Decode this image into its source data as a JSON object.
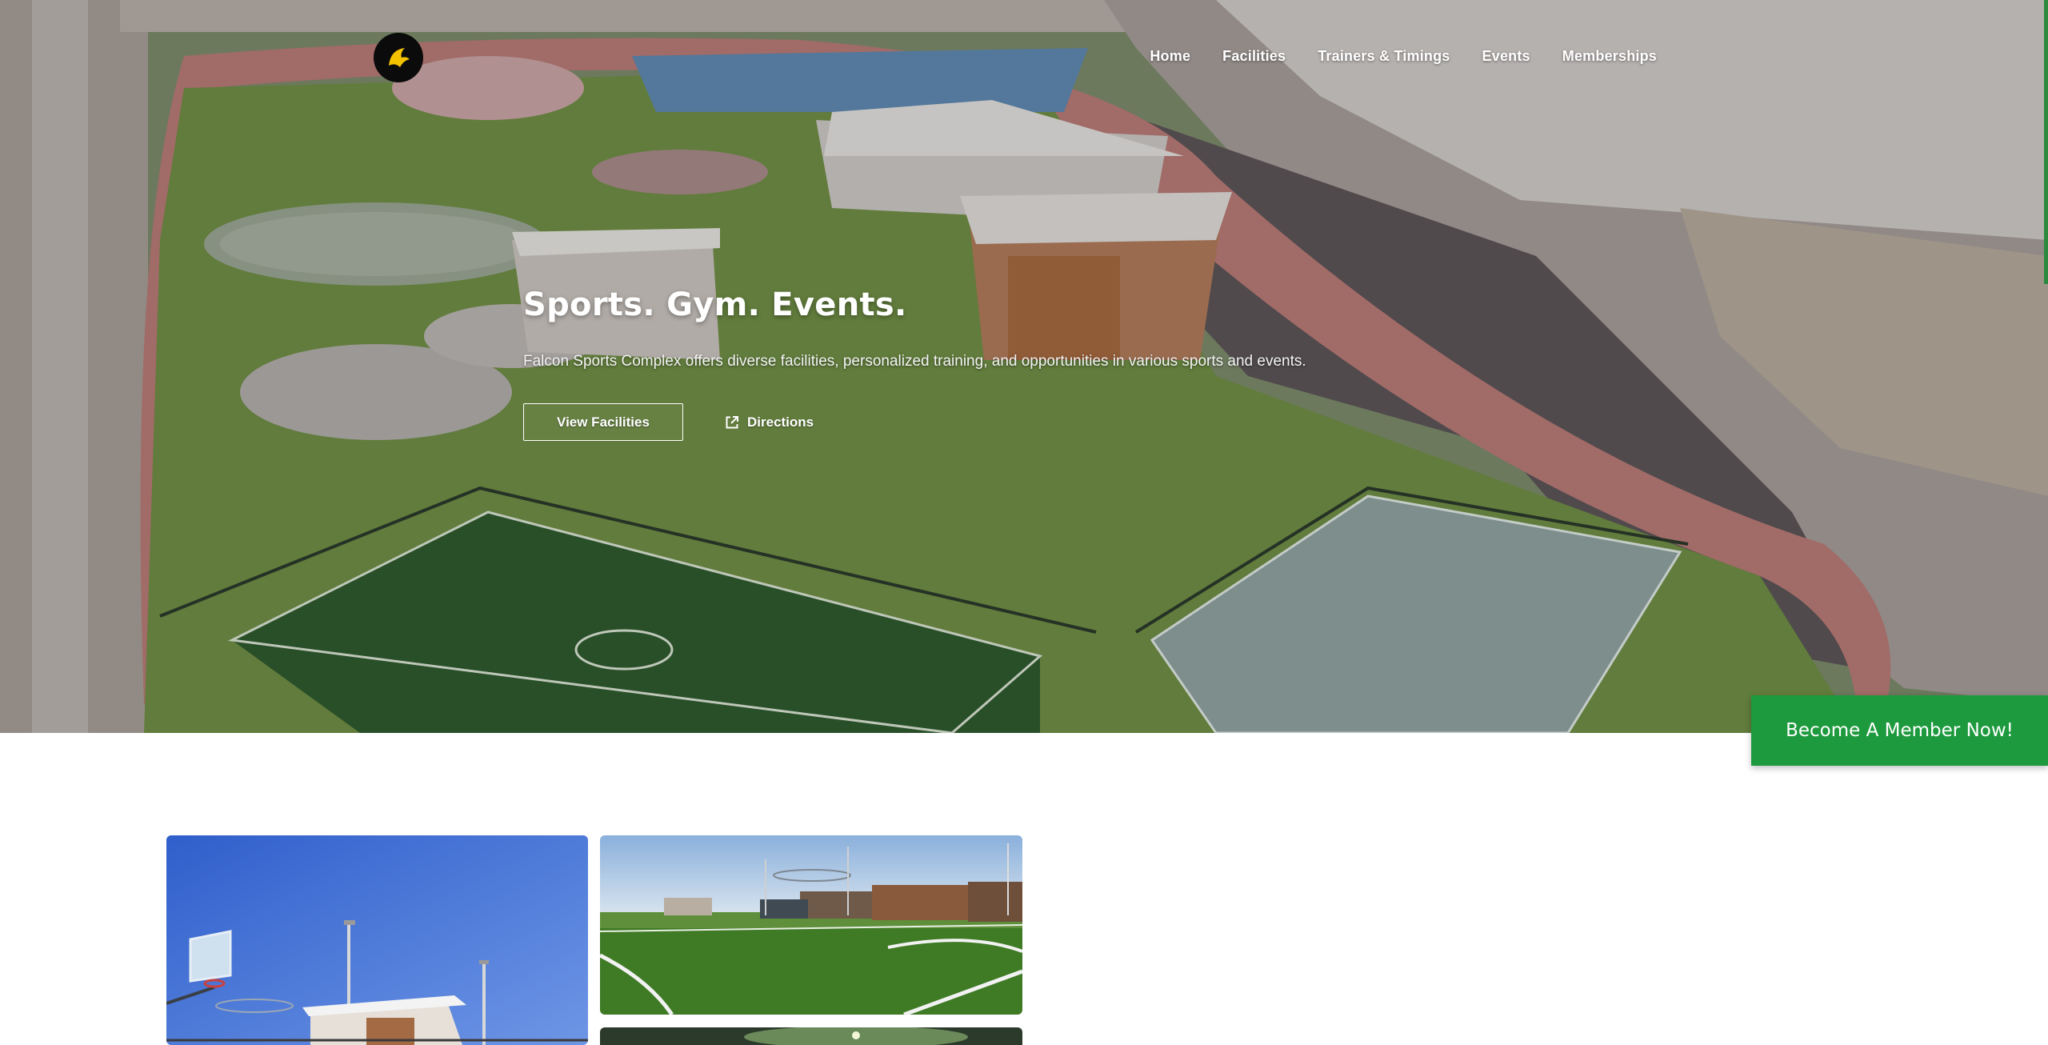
{
  "site": {
    "logo_icon": "falcon-logo-icon",
    "nav": [
      "Home",
      "Facilities",
      "Trainers & Timings",
      "Events",
      "Memberships"
    ]
  },
  "hero": {
    "title": "Sports. Gym. Events.",
    "subtitle": "Falcon Sports Complex offers diverse facilities, personalized training, and opportunities in various sports and events.",
    "primary_button": "View Facilities",
    "secondary_button": "Directions",
    "secondary_icon": "external-link-icon"
  },
  "cta": {
    "label": "Become A Member Now!",
    "color": "#1e9a3e"
  },
  "colors": {
    "accent_green": "#1e9a3e",
    "logo_yellow": "#f2c200"
  }
}
